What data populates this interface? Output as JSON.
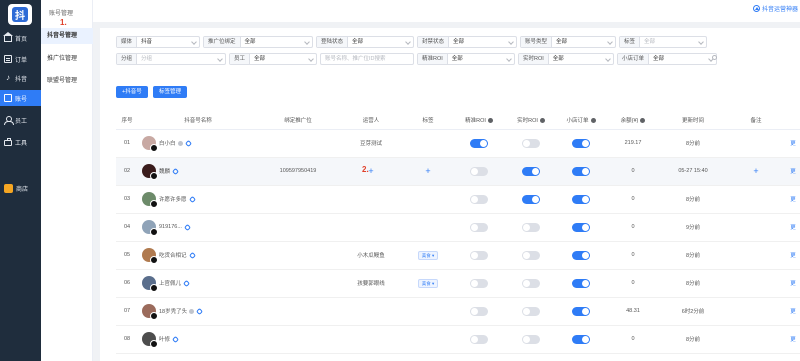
{
  "sidebar": {
    "logo_text": "抖",
    "items": [
      {
        "label": "首页",
        "icon": "home-icon",
        "active": false
      },
      {
        "label": "订单",
        "icon": "order-icon",
        "active": false
      },
      {
        "label": "抖音",
        "icon": "douyin-icon",
        "active": false
      },
      {
        "label": "账号",
        "icon": "account-icon",
        "active": true
      },
      {
        "label": "员工",
        "icon": "staff-icon",
        "active": false
      },
      {
        "label": "工具",
        "icon": "tools-icon",
        "active": false
      },
      {
        "label": "商店",
        "icon": "shop-icon",
        "active": false
      }
    ]
  },
  "subnav": {
    "title": "账号管理",
    "items": [
      "抖音号管理",
      "推广位管理",
      "联盟号管理"
    ]
  },
  "header": {
    "guide_link": "抖音运营神器"
  },
  "annotations": {
    "first": "1.",
    "second": "2."
  },
  "filters": {
    "row1": [
      {
        "label": "媒体",
        "value": "抖音"
      },
      {
        "label": "推广位绑定",
        "value": "全部"
      },
      {
        "label": "登陆状态",
        "value": "全部"
      },
      {
        "label": "封禁状态",
        "value": "全部"
      },
      {
        "label": "账号类型",
        "value": "全部"
      },
      {
        "label": "标签",
        "value": "全部",
        "placeholder": true
      }
    ],
    "row2": [
      {
        "label": "分组",
        "value": "分组",
        "placeholder": true
      },
      {
        "label": "员工",
        "value": "全部"
      },
      {
        "search_placeholder": "账号名称、推广位ID搜索"
      },
      {
        "label": "精准ROI",
        "value": "全部"
      },
      {
        "label": "实时ROI",
        "value": "全部"
      },
      {
        "label": "小店订单",
        "value": "全部"
      }
    ]
  },
  "buttons": {
    "add": "+抖音号",
    "tag_manage": "标签管理"
  },
  "table": {
    "headers": [
      "序号",
      "抖音号名称",
      "绑定推广位",
      "运营人",
      "标签",
      "精准ROI",
      "实时ROI",
      "小店订单",
      "余额(¥)",
      "更新时间",
      "备注",
      ""
    ],
    "rows": [
      {
        "index": "01",
        "name": "白小白",
        "promo": "",
        "operator": "豆芽测试",
        "tag": "",
        "precise_roi": "on",
        "realtime_roi": "off",
        "shop_order": "on",
        "balance": "219.17",
        "updated": "8分前",
        "remark": "",
        "action": "更",
        "avatar_color": "#c8a9a3"
      },
      {
        "index": "02",
        "name": "魏麟",
        "promo": "109597950419",
        "operator": "+",
        "tag": "+",
        "precise_roi": "off",
        "realtime_roi": "on",
        "shop_order": "on",
        "balance": "0",
        "updated": "05-27 15:40",
        "remark": "+",
        "action": "更",
        "avatar_color": "#3a1c1c",
        "highlight": true
      },
      {
        "index": "03",
        "name": "许愿许多愿",
        "promo": "",
        "operator": "",
        "tag": "",
        "precise_roi": "off",
        "realtime_roi": "on",
        "shop_order": "on",
        "balance": "0",
        "updated": "8分前",
        "remark": "",
        "action": "更",
        "avatar_color": "#6d8b6a"
      },
      {
        "index": "04",
        "name": "919176...",
        "promo": "",
        "operator": "",
        "tag": "",
        "precise_roi": "off",
        "realtime_roi": "off",
        "shop_order": "on",
        "balance": "0",
        "updated": "9分前",
        "remark": "",
        "action": "更",
        "avatar_color": "#8fa3b8"
      },
      {
        "index": "05",
        "name": "吃货合相记",
        "promo": "",
        "operator": "小木瓜鳗鱼",
        "tag": "美食",
        "precise_roi": "off",
        "realtime_roi": "off",
        "shop_order": "on",
        "balance": "0",
        "updated": "8分前",
        "remark": "",
        "action": "更",
        "avatar_color": "#b07a4f"
      },
      {
        "index": "06",
        "name": "上官佩儿",
        "promo": "",
        "operator": "孩要郭眼线",
        "tag": "美食",
        "precise_roi": "off",
        "realtime_roi": "off",
        "shop_order": "on",
        "balance": "0",
        "updated": "8分前",
        "remark": "",
        "action": "更",
        "avatar_color": "#5a6e8c"
      },
      {
        "index": "07",
        "name": "18岁秃了头",
        "promo": "",
        "operator": "",
        "tag": "",
        "precise_roi": "off",
        "realtime_roi": "off",
        "shop_order": "on",
        "balance": "48.31",
        "updated": "6时2分前",
        "remark": "",
        "action": "更",
        "avatar_color": "#9b6b5c"
      },
      {
        "index": "08",
        "name": "叶修",
        "promo": "",
        "operator": "",
        "tag": "",
        "precise_roi": "off",
        "realtime_roi": "off",
        "shop_order": "on",
        "balance": "0",
        "updated": "8分前",
        "remark": "",
        "action": "更",
        "avatar_color": "#4d4d4d"
      }
    ]
  },
  "colors": {
    "accent": "#2f7cf6",
    "sidebar": "#1f2d3d",
    "annotation": "#e0402a"
  }
}
